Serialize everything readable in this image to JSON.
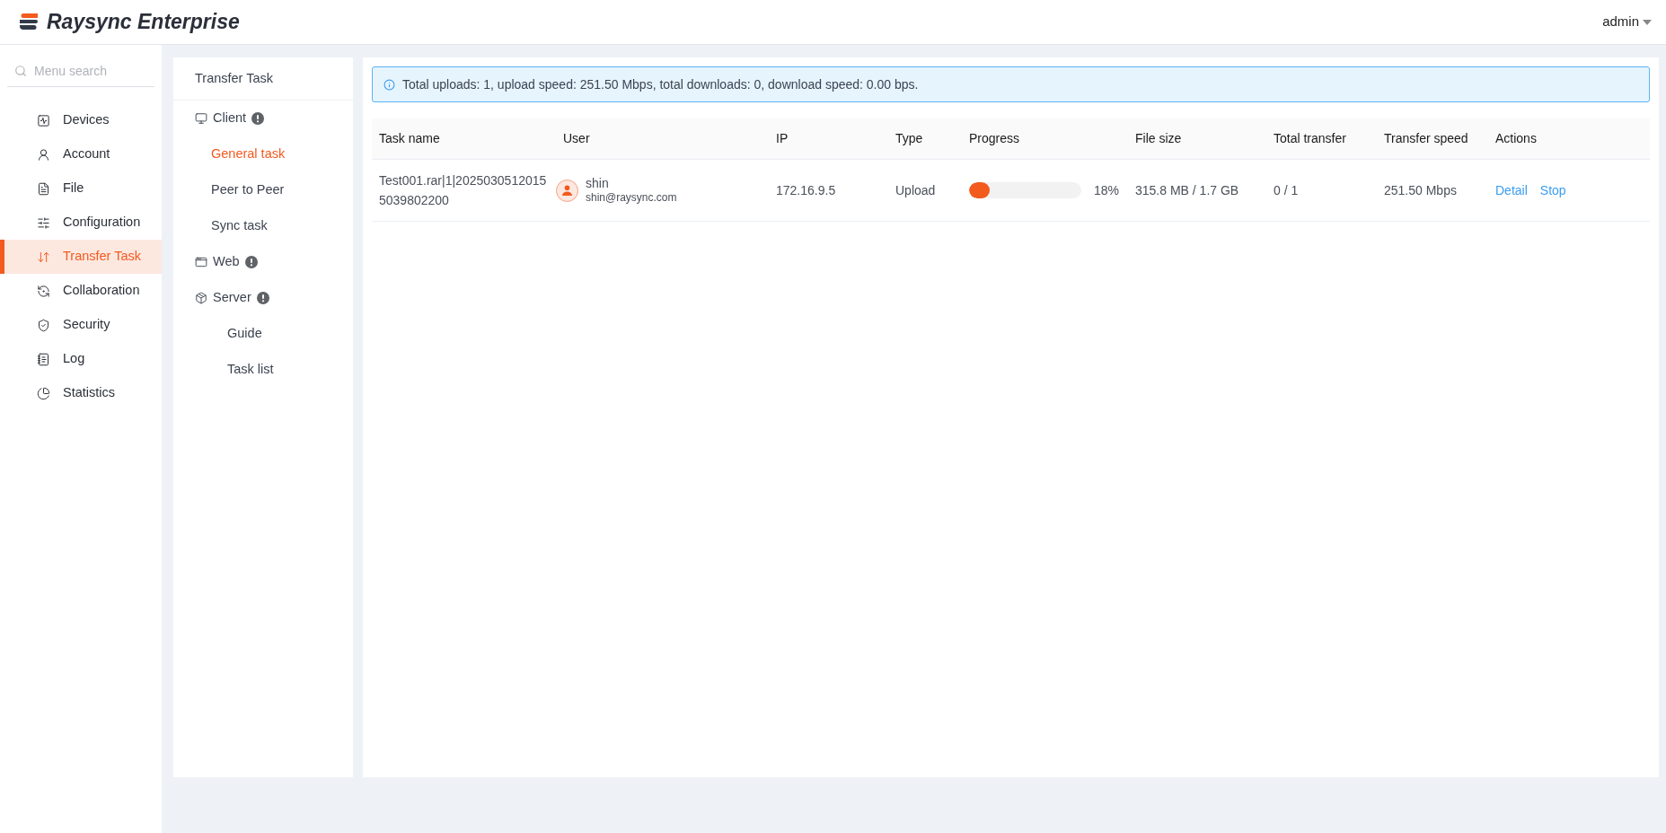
{
  "header": {
    "brand": "Raysync Enterprise",
    "user": "admin"
  },
  "sidebar": {
    "search": {
      "placeholder": "Menu search"
    },
    "items": [
      {
        "label": "Devices",
        "selected": false
      },
      {
        "label": "Account",
        "selected": false
      },
      {
        "label": "File",
        "selected": false
      },
      {
        "label": "Configuration",
        "selected": false
      },
      {
        "label": "Transfer Task",
        "selected": true
      },
      {
        "label": "Collaboration",
        "selected": false
      },
      {
        "label": "Security",
        "selected": false
      },
      {
        "label": "Log",
        "selected": false
      },
      {
        "label": "Statistics",
        "selected": false
      }
    ]
  },
  "subnav": {
    "title": "Transfer Task",
    "groups": [
      {
        "label": "Client",
        "alert": true,
        "children": [
          {
            "label": "General task",
            "selected": true
          },
          {
            "label": "Peer to Peer",
            "selected": false
          },
          {
            "label": "Sync task",
            "selected": false
          }
        ]
      },
      {
        "label": "Web",
        "alert": true
      },
      {
        "label": "Server",
        "alert": true,
        "children": [
          {
            "label": "Guide",
            "selected": false
          },
          {
            "label": "Task list",
            "selected": false
          }
        ]
      }
    ]
  },
  "notice": "Total uploads: 1, upload speed: 251.50 Mbps, total downloads: 0, download speed: 0.00 bps.",
  "table": {
    "columns": [
      "Task name",
      "User",
      "IP",
      "Type",
      "Progress",
      "File size",
      "Total transfer",
      "Transfer speed",
      "Actions"
    ],
    "rows": [
      {
        "task_name": "Test001.rar|1|20250305120155039802200",
        "user_name": "shin",
        "user_email": "shin@raysync.com",
        "ip": "172.16.9.5",
        "type": "Upload",
        "level": 0.18,
        "progress": "18%",
        "file_size": "315.8 MB / 1.7 GB",
        "total_transfer": "0 / 1",
        "transfer_speed": "251.50 Mbps",
        "actions": [
          "Detail",
          "Stop"
        ]
      }
    ]
  }
}
